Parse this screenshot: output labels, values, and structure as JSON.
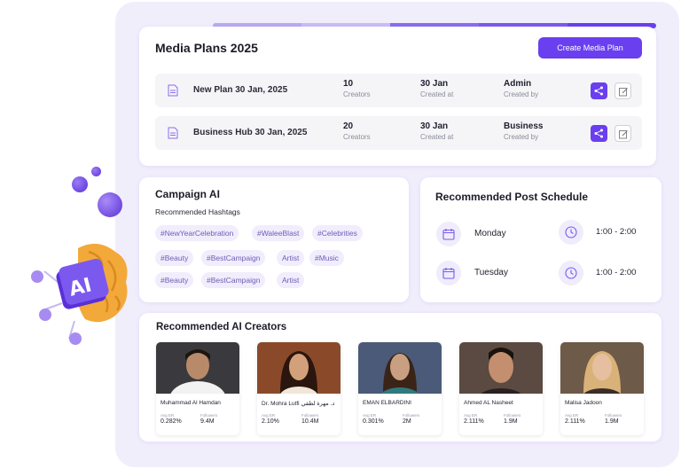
{
  "colors": {
    "accent": "#6a3ff0",
    "frame": "#f1eefc",
    "tag_bg": "#f1edfc",
    "tag_text": "#6d5fb8"
  },
  "media_plans": {
    "title": "Media Plans 2025",
    "create_label": "Create Media Plan",
    "rows": [
      {
        "name": "New Plan 30 Jan, 2025",
        "creators": "10",
        "creators_label": "Creators",
        "created_at": "30 Jan",
        "created_at_label": "Created at",
        "created_by": "Admin",
        "created_by_label": "Created by"
      },
      {
        "name": "Business Hub 30 Jan, 2025",
        "creators": "20",
        "creators_label": "Creators",
        "created_at": "30 Jan",
        "created_at_label": "Created at",
        "created_by": "Business",
        "created_by_label": "Created by"
      }
    ]
  },
  "campaign_ai": {
    "title": "Campaign AI",
    "subtitle": "Recommended Hashtags",
    "tags": [
      "#NewYearCelebration",
      "#WaleeBlast",
      "#Celebrities",
      "#Beauty",
      "#BestCampaign",
      "Artist",
      "#Music",
      "#Beauty",
      "#BestCampaign",
      "Artist"
    ]
  },
  "schedule": {
    "title": "Recommended Post Schedule",
    "items": [
      {
        "day": "Monday",
        "time": "1:00 - 2:00"
      },
      {
        "day": "Tuesday",
        "time": "1:00 - 2:00"
      }
    ]
  },
  "creators": {
    "title": "Recommended AI Creators",
    "list": [
      {
        "name": "Muhammad Al Hamdan",
        "er_label": "Avg ER",
        "er": "0.282%",
        "followers_label": "Followers",
        "followers": "9.4M"
      },
      {
        "name": "Dr. Mohra Lutfi  د. مهرة لطفي",
        "er_label": "Avg ER",
        "er": "2.10%",
        "followers_label": "Followers",
        "followers": "10.4M"
      },
      {
        "name": "EMAN ELBARDINI",
        "er_label": "Avg ER",
        "er": "0.301%",
        "followers_label": "Followers",
        "followers": "2M"
      },
      {
        "name": "Ahmed AL Nasheet",
        "er_label": "Avg ER",
        "er": "2.111%",
        "followers_label": "Followers",
        "followers": "1.9M"
      },
      {
        "name": "Malisa Jadoon",
        "er_label": "Avg ER",
        "er": "2.111%",
        "followers_label": "Followers",
        "followers": "1.9M"
      }
    ]
  },
  "decor": {
    "ai_badge": "AI",
    "icons": [
      "brain-icon",
      "document-icon",
      "share-icon",
      "edit-icon",
      "calendar-icon",
      "clock-icon"
    ]
  }
}
